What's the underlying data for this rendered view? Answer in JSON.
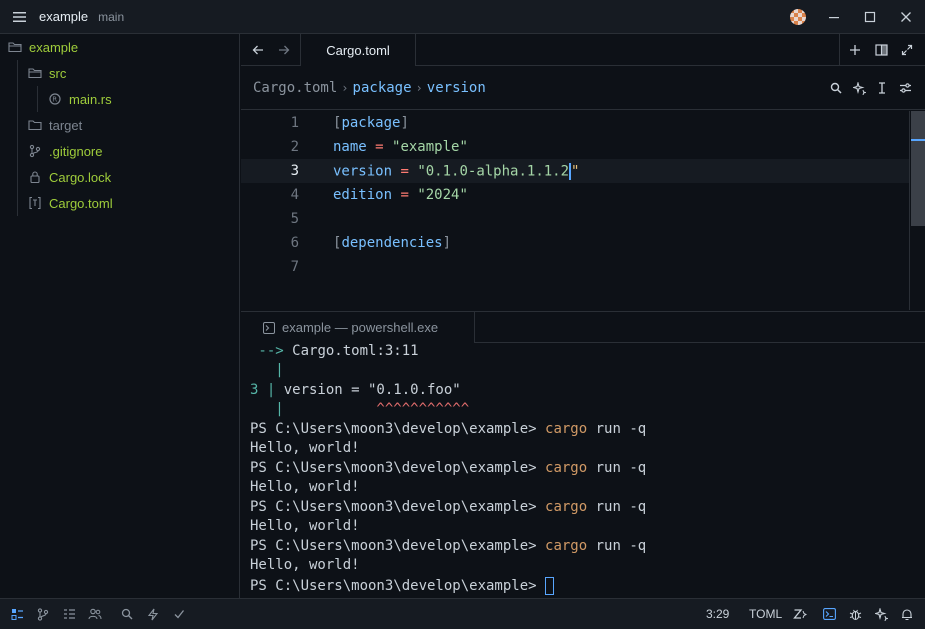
{
  "titlebar": {
    "project": "example",
    "branch": "main",
    "icons": [
      "menu-icon",
      "avatar",
      "minimize-icon",
      "maximize-icon",
      "close-icon"
    ]
  },
  "sidebar": {
    "root": "example",
    "items": [
      {
        "label": "src",
        "icon": "folder-icon"
      },
      {
        "label": "main.rs",
        "icon": "rust-file-icon"
      },
      {
        "label": "target",
        "icon": "folder-icon"
      },
      {
        "label": ".gitignore",
        "icon": "git-icon"
      },
      {
        "label": "Cargo.lock",
        "icon": "lock-icon"
      },
      {
        "label": "Cargo.toml",
        "icon": "toml-icon"
      }
    ]
  },
  "editor": {
    "tab_label": "Cargo.toml",
    "breadcrumb": {
      "file": "Cargo.toml",
      "section": "package",
      "key": "version"
    },
    "lines": [
      {
        "num": "1",
        "parts": [
          [
            "[",
            "br"
          ],
          [
            "package",
            "sec"
          ],
          [
            "]",
            "br"
          ]
        ]
      },
      {
        "num": "2",
        "parts": [
          [
            "name",
            "key"
          ],
          [
            " = ",
            "eq"
          ],
          [
            "\"example\"",
            "str"
          ]
        ]
      },
      {
        "num": "3",
        "parts": [
          [
            "version",
            "key"
          ],
          [
            " = ",
            "eq"
          ],
          [
            "\"0.1.0-alpha.1.1.2",
            "str"
          ],
          [
            "\"",
            "q"
          ]
        ]
      },
      {
        "num": "4",
        "parts": [
          [
            "edition",
            "key"
          ],
          [
            " = ",
            "eq"
          ],
          [
            "\"2024\"",
            "str"
          ]
        ]
      },
      {
        "num": "5",
        "parts": []
      },
      {
        "num": "6",
        "parts": [
          [
            "[",
            "br"
          ],
          [
            "dependencies",
            "sec"
          ],
          [
            "]",
            "br"
          ]
        ]
      },
      {
        "num": "7",
        "parts": []
      }
    ],
    "active_line": "3"
  },
  "terminal": {
    "tab_label": "example — powershell.exe",
    "lines": [
      [
        [
          " --> ",
          "teal"
        ],
        [
          "Cargo.toml:3:11",
          "plain"
        ]
      ],
      [
        [
          "   |",
          "teal"
        ]
      ],
      [
        [
          "3 | ",
          "teal"
        ],
        [
          "version = \"0.1.0.foo\"",
          "plain"
        ]
      ],
      [
        [
          "   |",
          "teal"
        ],
        [
          "           ^^^^^^^^^^^",
          "err"
        ]
      ],
      [
        [
          "PS C:\\Users\\moon3\\develop\\example> ",
          "plain"
        ],
        [
          "cargo",
          "cmd"
        ],
        [
          " run -q",
          "plain"
        ]
      ],
      [
        [
          "Hello, world!",
          "plain"
        ]
      ],
      [
        [
          "PS C:\\Users\\moon3\\develop\\example> ",
          "plain"
        ],
        [
          "cargo",
          "cmd"
        ],
        [
          " run -q",
          "plain"
        ]
      ],
      [
        [
          "Hello, world!",
          "plain"
        ]
      ],
      [
        [
          "PS C:\\Users\\moon3\\develop\\example> ",
          "plain"
        ],
        [
          "cargo",
          "cmd"
        ],
        [
          " run -q",
          "plain"
        ]
      ],
      [
        [
          "Hello, world!",
          "plain"
        ]
      ],
      [
        [
          "PS C:\\Users\\moon3\\develop\\example> ",
          "plain"
        ],
        [
          "cargo",
          "cmd"
        ],
        [
          " run -q",
          "plain"
        ]
      ],
      [
        [
          "Hello, world!",
          "plain"
        ]
      ],
      [
        [
          "PS C:\\Users\\moon3\\develop\\example> ",
          "plain"
        ]
      ]
    ]
  },
  "statusbar": {
    "cursor_pos": "3:29",
    "language": "TOML"
  },
  "colors": {
    "accent": "#58a6ff",
    "file_green": "#9fcd3b",
    "background": "#0d1117"
  }
}
